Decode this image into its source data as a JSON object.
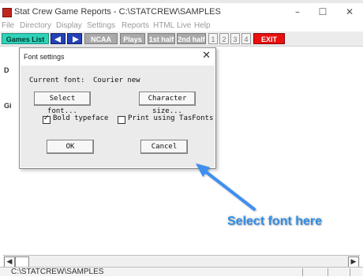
{
  "window": {
    "title": "Stat Crew Game Reports - C:\\STATCREW\\SAMPLES",
    "minimize": "–",
    "maximize": "☐",
    "close": "✕"
  },
  "menu": [
    "File",
    "Directory",
    "Display",
    "Settings",
    "Reports",
    "HTML",
    "Live",
    "Help"
  ],
  "toolbar": {
    "games_list": "Games List",
    "ncaa_box": "NCAA Box",
    "plays": "Plays",
    "first_half": "1st half",
    "second_half": "2nd half",
    "periods": [
      "1",
      "2",
      "3",
      "4"
    ],
    "exit": "EXIT",
    "colors": {
      "games_list": "#2fd3b9",
      "nav": "#2342b8",
      "report": "#a9a9a9",
      "exit": "#ea1010"
    }
  },
  "background_labels": {
    "d": "D",
    "g": "Gi"
  },
  "dialog": {
    "title": "Font settings",
    "close": "✕",
    "current_font_label": "Current font:",
    "current_font_value": "Courier new",
    "select_font": "Select font...",
    "character_size": "Character size...",
    "bold_typeface": "Bold typeface",
    "bold_checked": true,
    "check_mark": "✓",
    "tasfonts": "Print using TasFonts",
    "tasfonts_checked": false,
    "ok": "OK",
    "cancel": "Cancel"
  },
  "annotation": {
    "text": "Select font here",
    "color": "#2f8ee8"
  },
  "scrollbar": {
    "left_arrow": "◀",
    "right_arrow": "▶"
  },
  "status": {
    "path": "C:\\STATCREW\\SAMPLES"
  }
}
